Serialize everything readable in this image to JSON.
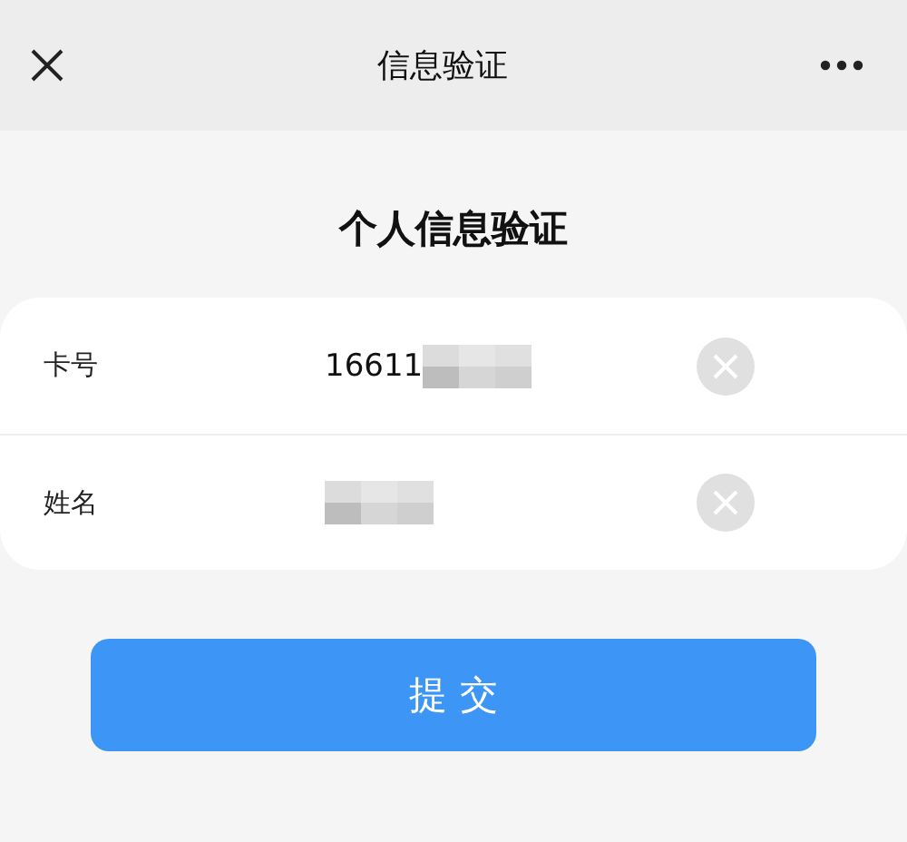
{
  "nav_bar": {
    "title": "信息验证"
  },
  "heading": "个人信息验证",
  "fields": [
    {
      "label": "卡号",
      "value": "16611",
      "masked": true
    },
    {
      "label": "姓名",
      "masked": true
    }
  ],
  "submit_button": "提 交"
}
